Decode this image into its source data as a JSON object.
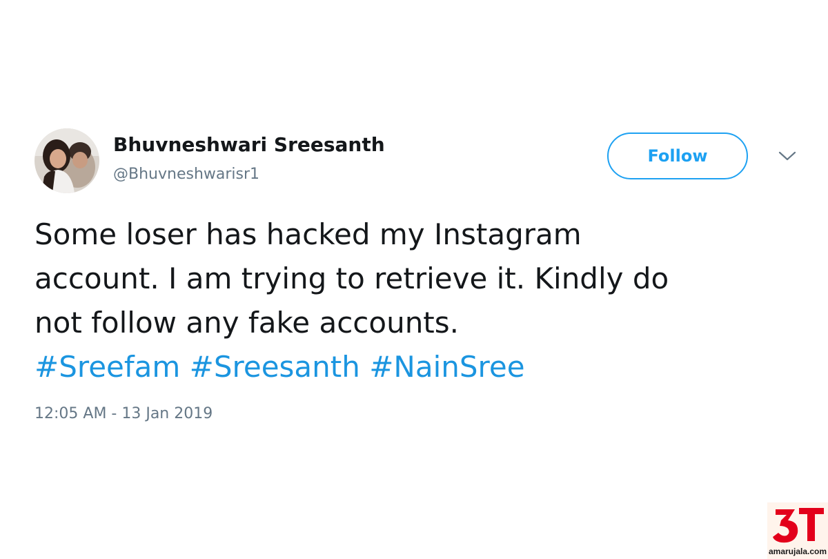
{
  "tweet": {
    "user": {
      "display_name": "Bhuvneshwari Sreesanth",
      "handle": "@Bhuvneshwarisr1",
      "avatar_icon": "profile-photo"
    },
    "follow_label": "Follow",
    "menu_icon": "chevron-down-icon",
    "text_lines": [
      "Some loser has hacked my Instagram",
      "account. I am trying to retrieve it. Kindly do",
      "not follow any fake accounts."
    ],
    "hashtags": [
      "#Sreefam",
      "#Sreesanth",
      "#NainSree"
    ],
    "timestamp": "12:05 AM - 13 Jan 2019"
  },
  "watermark": {
    "logo_text": "3T",
    "site": "amarujala.com"
  },
  "colors": {
    "accent": "#1da1f2",
    "hashtag": "#1b95e0",
    "text": "#14171a",
    "muted": "#657786",
    "logo_red": "#e3001b"
  }
}
